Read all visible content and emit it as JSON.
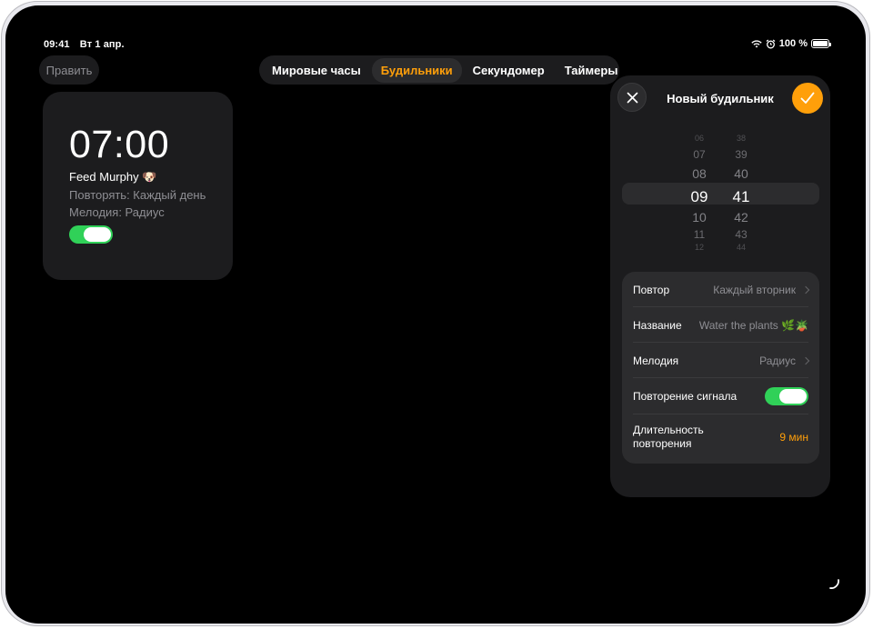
{
  "status_bar": {
    "time": "09:41",
    "date": "Вт 1 апр.",
    "battery": "100 %"
  },
  "edit_label": "Править",
  "tabs": [
    {
      "label": "Мировые часы",
      "active": false
    },
    {
      "label": "Будильники",
      "active": true
    },
    {
      "label": "Секундомер",
      "active": false
    },
    {
      "label": "Таймеры",
      "active": false
    }
  ],
  "alarm": {
    "time": "07:00",
    "name": "Feed Murphy 🐶",
    "repeat": "Повторять: Каждый день",
    "sound": "Мелодия: Радиус",
    "enabled": true
  },
  "new_alarm": {
    "title": "Новый будильник",
    "hours": [
      "06",
      "07",
      "08",
      "09",
      "10",
      "11",
      "12"
    ],
    "minutes": [
      "38",
      "39",
      "40",
      "41",
      "42",
      "43",
      "44"
    ],
    "selected_hour": "09",
    "selected_minute": "41",
    "settings": {
      "repeat_label": "Повтор",
      "repeat_value": "Каждый вторник",
      "name_label": "Название",
      "name_value": "Water the plants 🌿🪴",
      "sound_label": "Мелодия",
      "sound_value": "Радиус",
      "snooze_label": "Повторение сигнала",
      "snooze_enabled": true,
      "duration_label": "Длительность повторения",
      "duration_value": "9 мин"
    }
  },
  "colors": {
    "accent": "#ff9f0a",
    "toggle_on": "#30d158",
    "card": "#1c1c1e",
    "row": "#2c2c2e"
  }
}
